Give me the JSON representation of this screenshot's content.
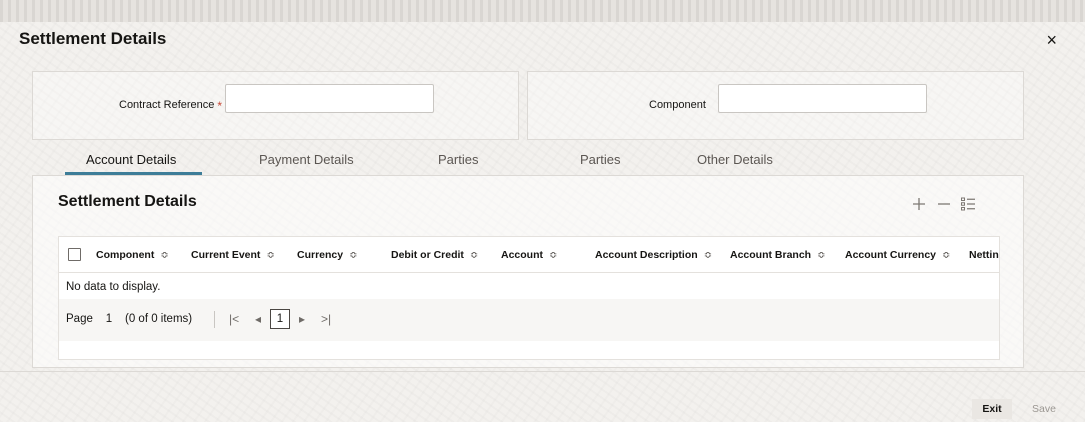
{
  "dialog": {
    "title": "Settlement Details",
    "close_label": "×"
  },
  "fields": {
    "contract_reference": {
      "label": "Contract Reference",
      "required": "*",
      "value": ""
    },
    "component": {
      "label": "Component",
      "value": ""
    }
  },
  "tabs": [
    {
      "label": "Account Details",
      "active": true
    },
    {
      "label": "Payment Details"
    },
    {
      "label": "Parties"
    },
    {
      "label": "Parties"
    },
    {
      "label": "Other Details"
    }
  ],
  "panel": {
    "title": "Settlement Details",
    "icons": {
      "add": "plus-icon",
      "remove": "minus-icon",
      "columns": "column-list-icon"
    }
  },
  "table": {
    "columns": [
      "Component",
      "Current Event",
      "Currency",
      "Debit or Credit",
      "Account",
      "Account Description",
      "Account Branch",
      "Account Currency",
      "Nettin"
    ],
    "sort_glyph": "≎",
    "empty_text": "No data to display."
  },
  "pagination": {
    "page_label": "Page",
    "page_value": "1",
    "items_text": "(0 of 0 items)",
    "current_page": "1",
    "first": "|<",
    "prev": "◂",
    "next": "▸",
    "last": ">|"
  },
  "footer": {
    "exit_label": "Exit",
    "save_label": "Save"
  },
  "colors": {
    "accent": "#3d7d98",
    "required": "#c74634"
  }
}
